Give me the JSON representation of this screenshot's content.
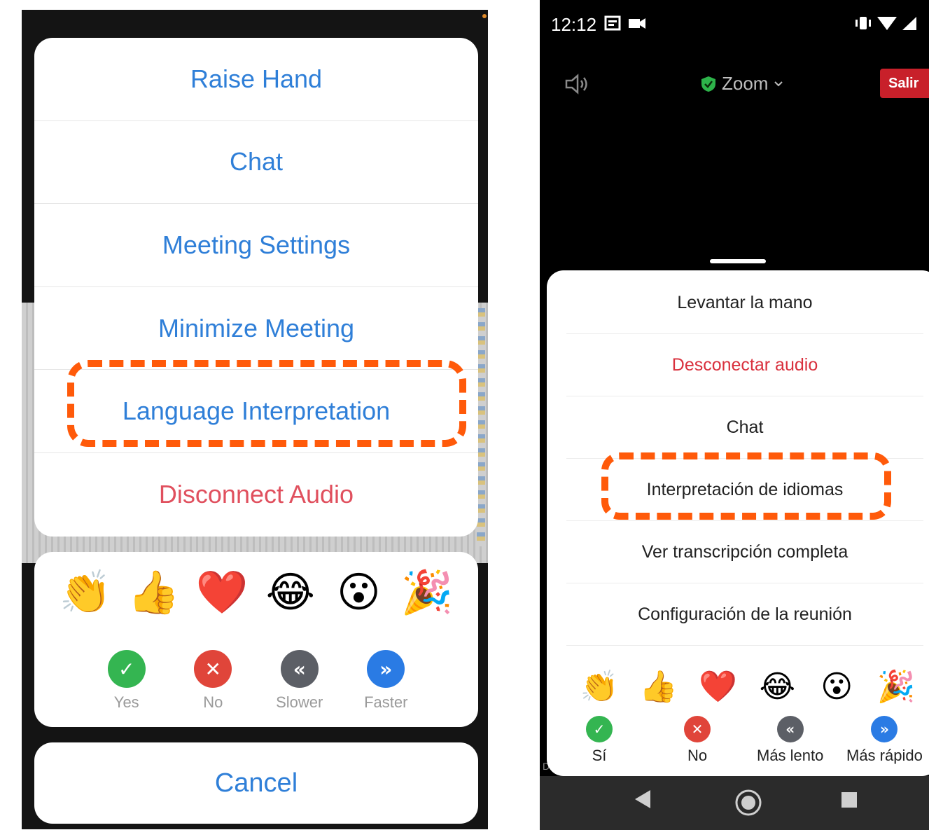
{
  "ios": {
    "menu": [
      {
        "label": "Raise Hand",
        "type": "normal"
      },
      {
        "label": "Chat",
        "type": "normal"
      },
      {
        "label": "Meeting Settings",
        "type": "normal"
      },
      {
        "label": "Minimize Meeting",
        "type": "normal"
      },
      {
        "label": "Language Interpretation",
        "type": "highlighted"
      },
      {
        "label": "Disconnect Audio",
        "type": "danger"
      }
    ],
    "reactions": [
      "👏",
      "👍",
      "❤️",
      "😂",
      "😮",
      "🎉"
    ],
    "feedback": [
      {
        "label": "Yes",
        "glyph": "✓",
        "color": "#34b551",
        "icon": "check-icon"
      },
      {
        "label": "No",
        "glyph": "✕",
        "color": "#e0453a",
        "icon": "cross-icon"
      },
      {
        "label": "Slower",
        "glyph": "«",
        "color": "#5c5f66",
        "icon": "slower-icon"
      },
      {
        "label": "Faster",
        "glyph": "»",
        "color": "#2a7be4",
        "icon": "faster-icon"
      }
    ],
    "cancel_label": "Cancel"
  },
  "android": {
    "status_time": "12:12",
    "meeting_title": "Zoom",
    "leave_label": "Salir",
    "menu": [
      {
        "label": "Levantar la mano",
        "type": "normal"
      },
      {
        "label": "Desconectar audio",
        "type": "danger"
      },
      {
        "label": "Chat",
        "type": "normal"
      },
      {
        "label": "Interpretación de idiomas",
        "type": "highlighted"
      },
      {
        "label": "Ver transcripción completa",
        "type": "normal"
      },
      {
        "label": "Configuración de la reunión",
        "type": "normal"
      }
    ],
    "reactions": [
      "👏",
      "👍",
      "❤️",
      "😂",
      "😮",
      "🎉"
    ],
    "feedback": [
      {
        "label": "Sí",
        "glyph": "✓",
        "color": "#34b551",
        "icon": "check-icon"
      },
      {
        "label": "No",
        "glyph": "✕",
        "color": "#e0453a",
        "icon": "cross-icon"
      },
      {
        "label": "Más lento",
        "glyph": "«",
        "color": "#5c5f66",
        "icon": "slower-icon"
      },
      {
        "label": "Más rápido",
        "glyph": "»",
        "color": "#2a7be4",
        "icon": "faster-icon"
      }
    ]
  },
  "colors": {
    "highlight": "#ff5a0a",
    "ios_accent": "#2f7fd8",
    "ios_danger": "#e0505e",
    "android_danger": "#d9303d",
    "leave_button": "#c8202a"
  }
}
